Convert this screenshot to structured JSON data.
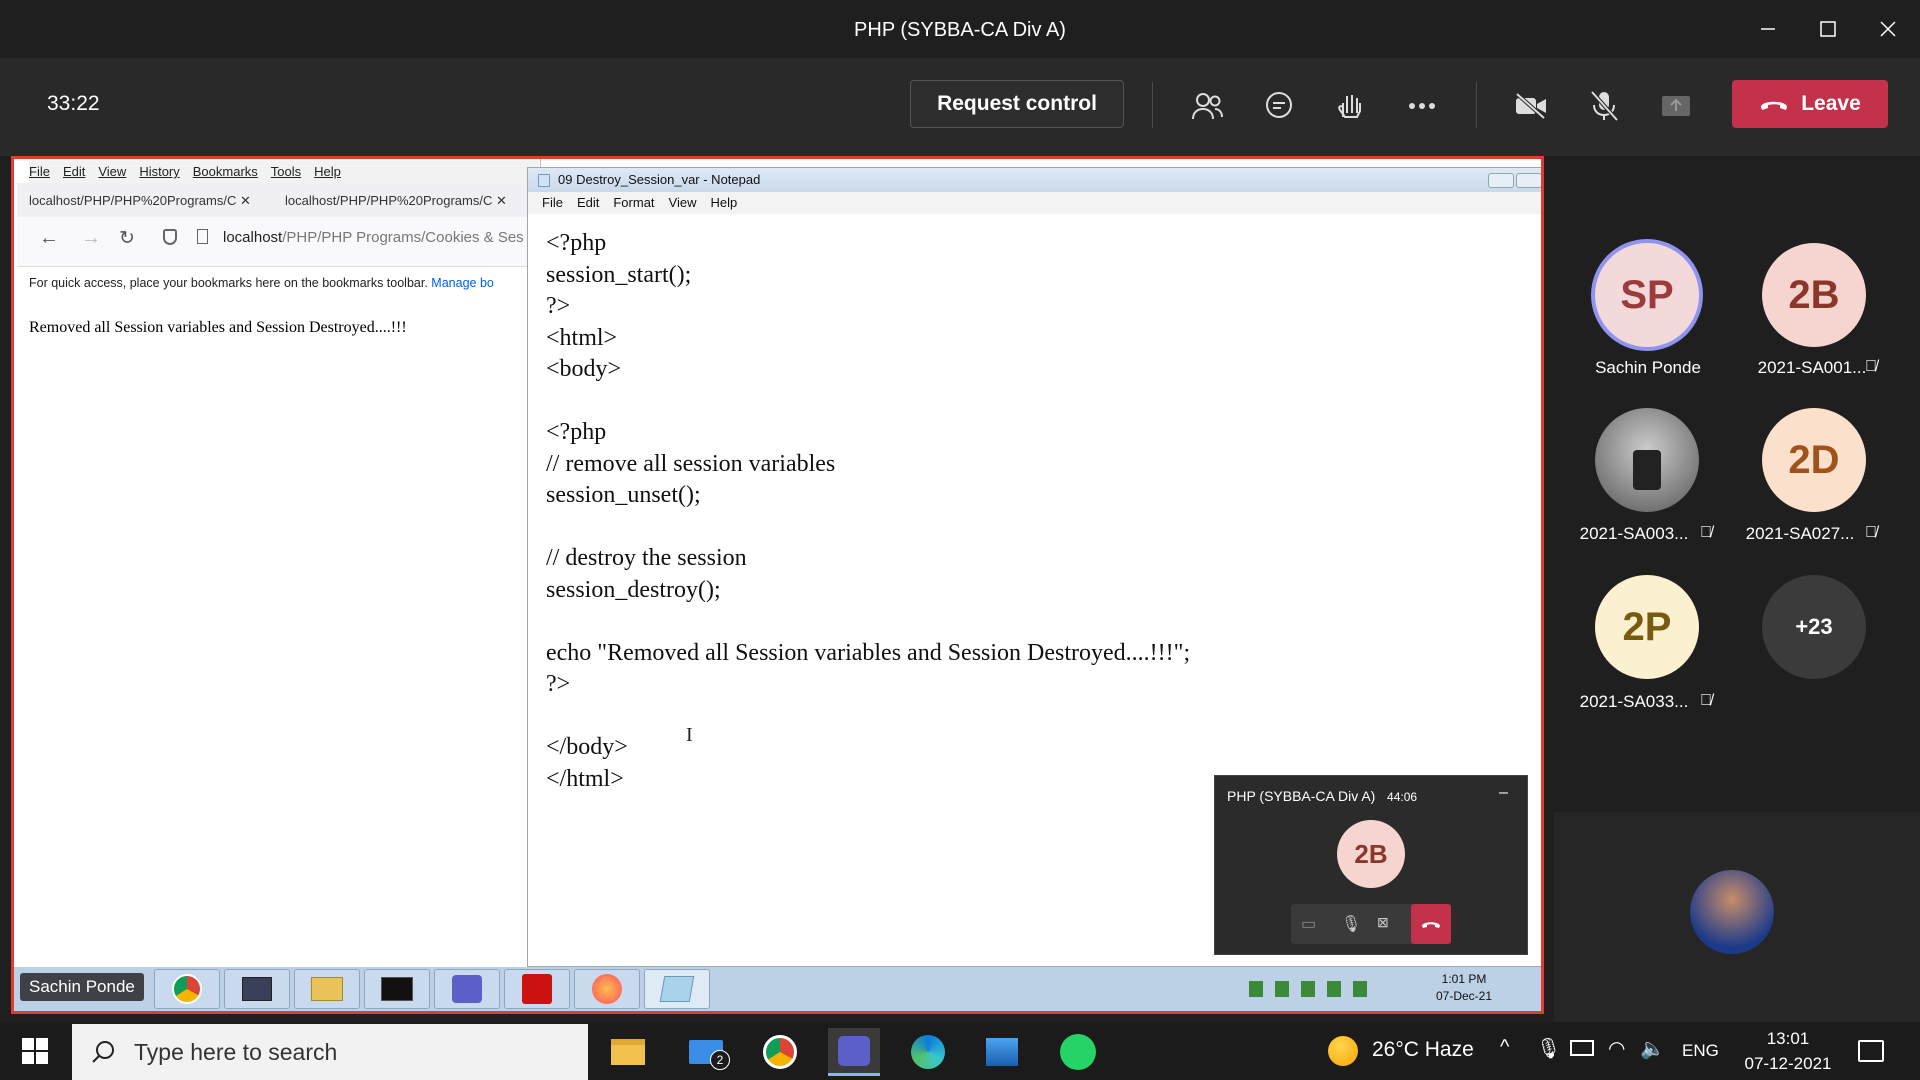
{
  "window": {
    "title": "PHP (SYBBA-CA Div A)"
  },
  "meeting": {
    "timer": "33:22",
    "request_control": "Request control",
    "leave": "Leave"
  },
  "browser": {
    "menu": [
      "File",
      "Edit",
      "View",
      "History",
      "Bookmarks",
      "Tools",
      "Help"
    ],
    "tabs": [
      "localhost/PHP/PHP%20Programs/C",
      "localhost/PHP/PHP%20Programs/C"
    ],
    "url_host": "localhost",
    "url_path": "/PHP/PHP Programs/Cookies & Ses",
    "bookmarks_msg": "For quick access, place your bookmarks here on the bookmarks toolbar.",
    "bookmarks_link": "Manage bo",
    "page_text": "Removed all Session variables and Session Destroyed....!!!"
  },
  "notepad": {
    "title": "09 Destroy_Session_var - Notepad",
    "menu": [
      "File",
      "Edit",
      "Format",
      "View",
      "Help"
    ],
    "code": "<?php\nsession_start();\n?>\n<html>\n<body>\n\n<?php\n// remove all session variables\nsession_unset();\n\n// destroy the session\nsession_destroy();\n\necho \"Removed all Session variables and Session Destroyed....!!!\";\n?>\n\n</body>\n</html>"
  },
  "mini_call": {
    "title": "PHP (SYBBA-CA Div A)",
    "time": "44:06",
    "avatar": "2B"
  },
  "inner_taskbar": {
    "presenter": "Sachin Ponde",
    "clock_time": "1:01 PM",
    "clock_date": "07-Dec-21"
  },
  "participants": [
    {
      "initials": "SP",
      "name": "Sachin Ponde",
      "bg": "#f3d9da",
      "fg": "#9b3b3b"
    },
    {
      "initials": "2B",
      "name": "2021-SA001...",
      "bg": "#f6d5d0",
      "fg": "#8a3628"
    },
    {
      "initials": "",
      "name": "2021-SA003...",
      "bg": "#777777",
      "fg": "#ffffff"
    },
    {
      "initials": "2D",
      "name": "2021-SA027...",
      "bg": "#fbe0cc",
      "fg": "#a0521d"
    },
    {
      "initials": "2P",
      "name": "2021-SA033...",
      "bg": "#fbf0cf",
      "fg": "#7a5a10"
    },
    {
      "initials": "+23",
      "name": "",
      "bg": "#3b3b3b",
      "fg": "#ffffff"
    }
  ],
  "win_taskbar": {
    "search_placeholder": "Type here to search",
    "weather": "26°C  Haze",
    "lang": "ENG",
    "time": "13:01",
    "date": "07-12-2021",
    "mail_badge": "2"
  }
}
